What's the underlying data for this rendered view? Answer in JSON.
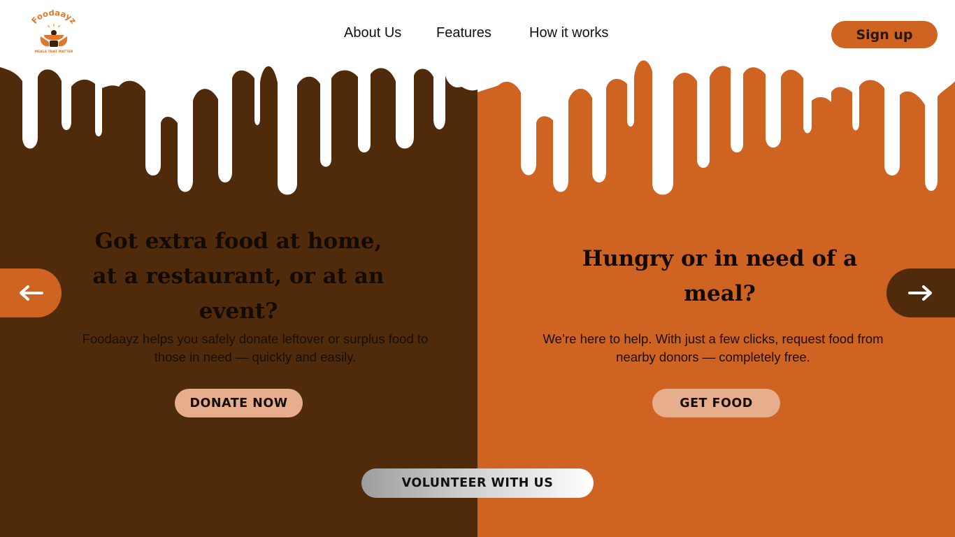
{
  "header": {
    "logo": {
      "brand": "Foodaayz",
      "tagline": "MEALS THAT MATTER"
    },
    "nav": [
      {
        "label": "About Us"
      },
      {
        "label": "Features"
      },
      {
        "label": "How it works"
      }
    ],
    "signup_label": "Sign up"
  },
  "left_panel": {
    "headline_lines": [
      "Got extra food at home,",
      "at a restaurant, or at an",
      "event?"
    ],
    "description_lines": [
      "Foodaayz helps you safely donate leftover or surplus food to",
      "those in need — quickly and easily."
    ],
    "cta_label": "DONATE NOW"
  },
  "right_panel": {
    "headline_lines": [
      "Hungry or in need of a",
      "meal?"
    ],
    "description_lines": [
      "We’re here to help. With just a few clicks, request food from",
      "nearby donors — completely free."
    ],
    "cta_label": "GET FOOD"
  },
  "volunteer_label": "VOLUNTEER WITH US",
  "carousel": {
    "prev_icon": "arrow-left-icon",
    "next_icon": "arrow-right-icon"
  },
  "colors": {
    "dark_brown": "#4f2b0b",
    "orange": "#cf6321",
    "peach": "#e7ae8d",
    "white": "#ffffff"
  }
}
